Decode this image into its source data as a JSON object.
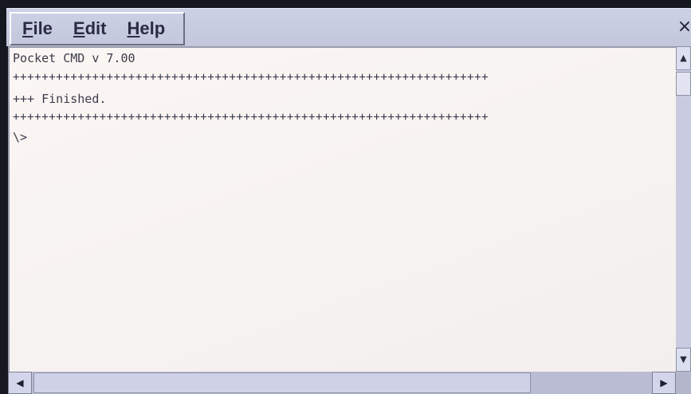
{
  "menubar": {
    "items": [
      {
        "access_key": "F",
        "rest": "ile"
      },
      {
        "access_key": "E",
        "rest": "dit"
      },
      {
        "access_key": "H",
        "rest": "elp"
      }
    ],
    "close_glyph": "×"
  },
  "console": {
    "lines": [
      "Pocket CMD v 7.00",
      "++++++++++++++++++++++++++++++++++++++++++++++++++++++++++++++++++",
      "+++ Finished.",
      "++++++++++++++++++++++++++++++++++++++++++++++++++++++++++++++++++",
      "\\>"
    ]
  },
  "scrollbars": {
    "up_glyph": "▲",
    "down_glyph": "▼",
    "left_glyph": "◀",
    "right_glyph": "▶"
  }
}
